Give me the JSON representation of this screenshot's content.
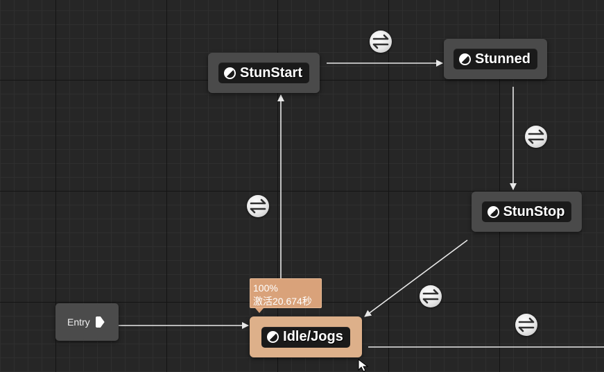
{
  "graph": {
    "entry": {
      "label": "Entry"
    },
    "states": [
      {
        "id": "stun-start",
        "label": "StunStart",
        "active": false
      },
      {
        "id": "stunned",
        "label": "Stunned",
        "active": false
      },
      {
        "id": "stun-stop",
        "label": "StunStop",
        "active": false
      },
      {
        "id": "idle-jogs",
        "label": "Idle/Jogs",
        "active": true
      }
    ],
    "transitions": [
      {
        "from": "Entry",
        "to": "Idle/Jogs"
      },
      {
        "from": "Idle/Jogs",
        "to": "StunStart"
      },
      {
        "from": "StunStart",
        "to": "Stunned"
      },
      {
        "from": "Stunned",
        "to": "StunStop"
      },
      {
        "from": "StunStop",
        "to": "Idle/Jogs"
      },
      {
        "from": "Idle/Jogs",
        "to": ""
      }
    ]
  },
  "debug_overlay": {
    "weight": "100%",
    "active_time": "激活20.674秒"
  },
  "colors": {
    "background": "#262626",
    "node": "#4a4a4a",
    "active_node": "#ddb08a",
    "wire": "#e8e8e8",
    "tooltip": "#d9a27a"
  }
}
